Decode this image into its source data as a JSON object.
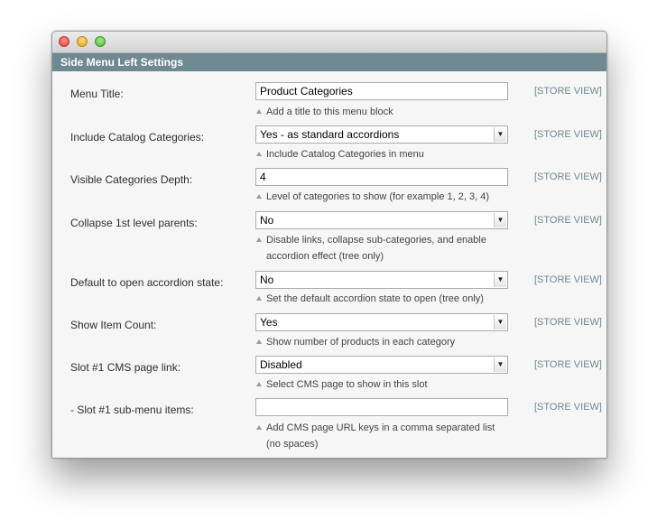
{
  "window": {
    "controls": [
      "close-button",
      "minimize-button",
      "zoom-button"
    ],
    "colors": {
      "header_bg": "#6f8992",
      "scope_text": "#6f8992",
      "body_bg": "#f6f6f6"
    }
  },
  "section": {
    "title": "Side Menu Left Settings"
  },
  "fields": [
    {
      "label": "Menu Title:",
      "value": "Product Categories",
      "type": "text",
      "scope": "[STORE VIEW]",
      "note": [
        "Add a title to this menu block"
      ]
    },
    {
      "label": "Include Catalog Categories:",
      "value": "Yes - as standard accordions",
      "type": "select",
      "scope": "[STORE VIEW]",
      "note": [
        "Include Catalog Categories in menu"
      ]
    },
    {
      "label": "Visible Categories Depth:",
      "value": "4",
      "type": "text",
      "scope": "[STORE VIEW]",
      "note": [
        "Level of categories to show (for example 1, 2, 3, 4)"
      ]
    },
    {
      "label": "Collapse 1st level parents:",
      "value": "No",
      "type": "select",
      "scope": "[STORE VIEW]",
      "note": [
        "Disable links, collapse sub-categories, and enable",
        "accordion effect (tree only)"
      ]
    },
    {
      "label": "Default to open accordion state:",
      "value": "No",
      "type": "select",
      "scope": "[STORE VIEW]",
      "note": [
        "Set the default accordion state to open (tree only)"
      ]
    },
    {
      "label": "Show Item Count:",
      "value": "Yes",
      "type": "select",
      "scope": "[STORE VIEW]",
      "note": [
        "Show number of products in each category"
      ]
    },
    {
      "label": "Slot #1 CMS page link:",
      "value": "Disabled",
      "type": "select",
      "scope": "[STORE VIEW]",
      "note": [
        "Select CMS page to show in this slot"
      ]
    },
    {
      "label": "- Slot #1 sub-menu items:",
      "value": "",
      "type": "text",
      "scope": "[STORE VIEW]",
      "note": [
        "Add CMS page URL keys in a comma separated list",
        "(no spaces)"
      ]
    }
  ]
}
